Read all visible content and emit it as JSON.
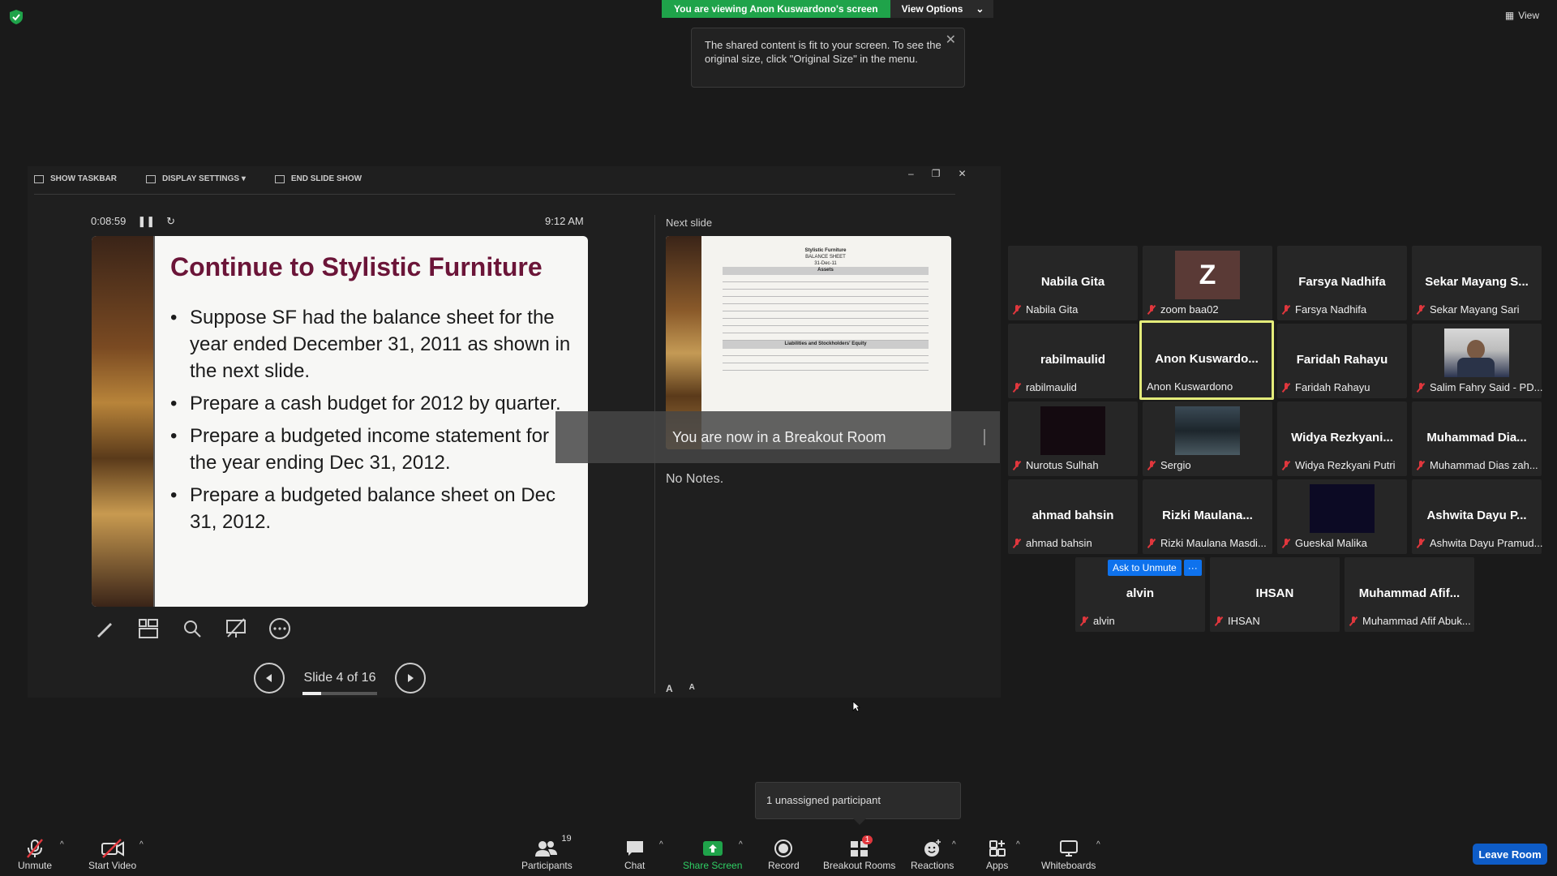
{
  "top": {
    "viewing_banner": "You are viewing Anon Kuswardono's screen",
    "view_options": "View Options",
    "view_label": "View",
    "tooltip": "The shared content is fit to your screen. To see the original size, click \"Original Size\" in the menu."
  },
  "presenter": {
    "toolbar": {
      "show_taskbar": "SHOW TASKBAR",
      "display_settings": "DISPLAY SETTINGS ▾",
      "end_slide_show": "END SLIDE SHOW"
    },
    "timer": "0:08:59",
    "clock": "9:12 AM",
    "slide": {
      "title": "Continue to Stylistic Furniture",
      "bullets": [
        "Suppose SF had the balance sheet for the year ended December 31, 2011 as shown in the next slide.",
        "Prepare a cash budget for 2012 by quarter.",
        "Prepare a budgeted income statement for the year ending Dec 31, 2012.",
        "Prepare a budgeted balance sheet on Dec 31, 2012."
      ]
    },
    "slide_counter": "Slide 4 of 16",
    "slide_progress": 0.25,
    "next_label": "Next slide",
    "next_slide": {
      "company": "Stylistic Furniture",
      "doc": "BALANCE SHEET",
      "date": "31-Dec-11",
      "assets_header": "Assets",
      "liabilities_header": "Liabilities and Stockholders' Equity"
    },
    "notes": "No Notes.",
    "font_increase": "A",
    "font_decrease": "A"
  },
  "breakout_toast": "You are now in a Breakout Room",
  "gallery": [
    {
      "big": "Nabila Gita",
      "name": "Nabila Gita"
    },
    {
      "big": "Z",
      "name": "zoom baa02"
    },
    {
      "big": "Farsya Nadhifa",
      "name": "Farsya Nadhifa"
    },
    {
      "big": "Sekar Mayang S...",
      "name": "Sekar Mayang Sari"
    },
    {
      "big": "rabilmaulid",
      "name": "rabilmaulid"
    },
    {
      "big": "Anon Kuswardo...",
      "name": "Anon Kuswardono"
    },
    {
      "big": "Faridah Rahayu",
      "name": "Faridah Rahayu"
    },
    {
      "big": "",
      "name": "Salim Fahry Said - PD..."
    },
    {
      "big": "",
      "name": "Nurotus Sulhah"
    },
    {
      "big": "",
      "name": "Sergio"
    },
    {
      "big": "Widya Rezkyani...",
      "name": "Widya Rezkyani Putri"
    },
    {
      "big": "Muhammad Dia...",
      "name": "Muhammad Dias zah..."
    },
    {
      "big": "ahmad bahsin",
      "name": "ahmad bahsin"
    },
    {
      "big": "Rizki Maulana...",
      "name": "Rizki Maulana Masdi..."
    },
    {
      "big": "",
      "name": "Gueskal Malika"
    },
    {
      "big": "Ashwita Dayu P...",
      "name": "Ashwita Dayu Pramud..."
    },
    {
      "big": "alvin",
      "name": "alvin"
    },
    {
      "big": "IHSAN",
      "name": "IHSAN"
    },
    {
      "big": "Muhammad Afif...",
      "name": "Muhammad Afif Abuk..."
    }
  ],
  "ask_to_unmute": "Ask to Unmute",
  "more_label": "···",
  "unassigned": "1 unassigned participant",
  "toolbar": {
    "unmute": "Unmute",
    "start_video": "Start Video",
    "participants": "Participants",
    "participants_count": "19",
    "chat": "Chat",
    "share_screen": "Share Screen",
    "record": "Record",
    "breakout_rooms": "Breakout Rooms",
    "breakout_badge": "1",
    "reactions": "Reactions",
    "apps": "Apps",
    "whiteboards": "Whiteboards",
    "leave_room": "Leave Room"
  },
  "colors": {
    "share_green": "#1fa34a",
    "accent_blue": "#0e72ed",
    "slide_title": "#6b1538",
    "mute_red": "#e0373d",
    "active_speaker": "#e4ec7a"
  }
}
